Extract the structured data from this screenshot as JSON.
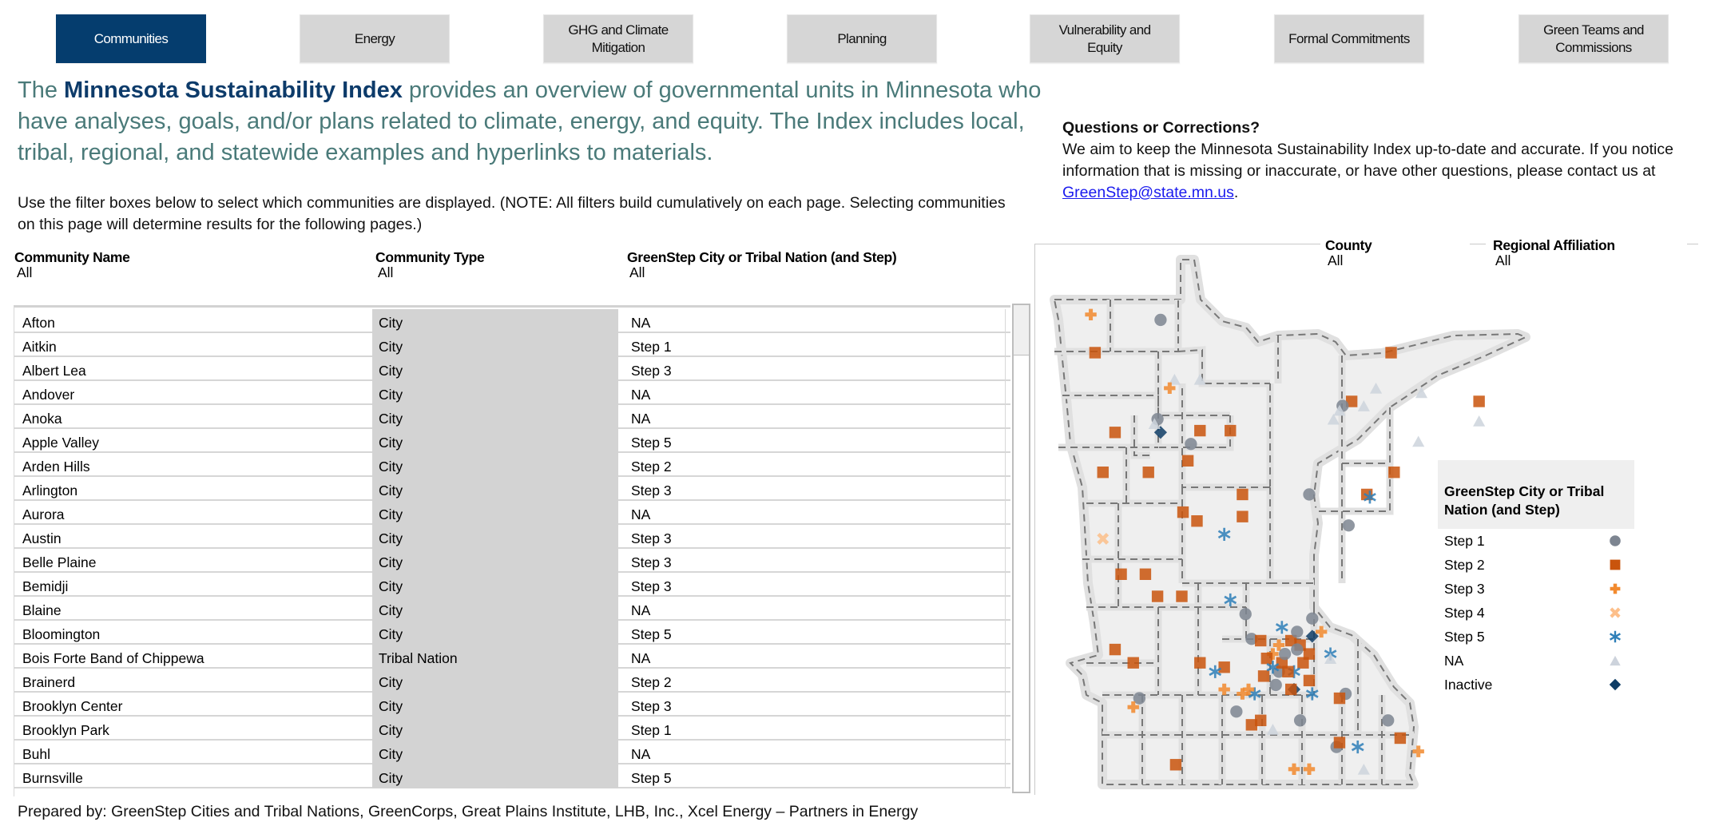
{
  "nav": {
    "tabs": [
      {
        "label": "Communities",
        "active": true
      },
      {
        "label": "Energy",
        "active": false
      },
      {
        "label": "GHG and Climate\nMitigation",
        "active": false
      },
      {
        "label": "Planning",
        "active": false
      },
      {
        "label": "Vulnerability and\nEquity",
        "active": false
      },
      {
        "label": "Formal Commitments",
        "active": false
      },
      {
        "label": "Green Teams and\nCommissions",
        "active": false
      }
    ]
  },
  "intro": {
    "prefix": "The ",
    "emphasis": "Minnesota Sustainability Index",
    "suffix": " provides an overview of governmental units in Minnesota who have analyses, goals, and/or plans related to climate, energy, and equity. The Index includes local, tribal, regional, and statewide examples and hyperlinks to materials."
  },
  "instructions": "Use the filter boxes below to select which communities are displayed. (NOTE: All filters build cumulatively on each page. Selecting communities on this page will determine results for the following pages.)",
  "questions": {
    "heading": "Questions or Corrections?",
    "body": "We aim to keep the Minnesota Sustainability Index up-to-date and accurate. If you notice information that is missing or inaccurate, or have other questions, please contact us at ",
    "email": "GreenStep@state.mn.us",
    "end": "."
  },
  "filters": {
    "community_name": {
      "label": "Community Name",
      "value": "All"
    },
    "community_type": {
      "label": "Community Type",
      "value": "All"
    },
    "greenstep": {
      "label": "GreenStep City or Tribal Nation (and Step)",
      "value": "All"
    },
    "county": {
      "label": "County",
      "value": "All"
    },
    "regional": {
      "label": "Regional Affiliation",
      "value": "All"
    }
  },
  "table": {
    "rows": [
      {
        "name": "Afton",
        "type": "City",
        "step": "NA"
      },
      {
        "name": "Aitkin",
        "type": "City",
        "step": "Step 1"
      },
      {
        "name": "Albert Lea",
        "type": "City",
        "step": "Step 3"
      },
      {
        "name": "Andover",
        "type": "City",
        "step": "NA"
      },
      {
        "name": "Anoka",
        "type": "City",
        "step": "NA"
      },
      {
        "name": "Apple Valley",
        "type": "City",
        "step": "Step 5"
      },
      {
        "name": "Arden Hills",
        "type": "City",
        "step": "Step 2"
      },
      {
        "name": "Arlington",
        "type": "City",
        "step": "Step 3"
      },
      {
        "name": "Aurora",
        "type": "City",
        "step": "NA"
      },
      {
        "name": "Austin",
        "type": "City",
        "step": "Step 3"
      },
      {
        "name": "Belle Plaine",
        "type": "City",
        "step": "Step 3"
      },
      {
        "name": "Bemidji",
        "type": "City",
        "step": "Step 3"
      },
      {
        "name": "Blaine",
        "type": "City",
        "step": "NA"
      },
      {
        "name": "Bloomington",
        "type": "City",
        "step": "Step 5"
      },
      {
        "name": "Bois Forte Band of Chippewa",
        "type": "Tribal Nation",
        "step": "NA"
      },
      {
        "name": "Brainerd",
        "type": "City",
        "step": "Step 2"
      },
      {
        "name": "Brooklyn Center",
        "type": "City",
        "step": "Step 3"
      },
      {
        "name": "Brooklyn Park",
        "type": "City",
        "step": "Step 1"
      },
      {
        "name": "Buhl",
        "type": "City",
        "step": "NA"
      },
      {
        "name": "Burnsville",
        "type": "City",
        "step": "Step 5"
      }
    ]
  },
  "legend": {
    "title": "GreenStep City or Tribal Nation (and Step)",
    "items": [
      {
        "label": "Step 1",
        "symbol": "circle",
        "color": "#7d8591"
      },
      {
        "label": "Step 2",
        "symbol": "square",
        "color": "#c9540c"
      },
      {
        "label": "Step 3",
        "symbol": "plus",
        "color": "#f28a2e"
      },
      {
        "label": "Step 4",
        "symbol": "cross",
        "color": "#fdbf8a"
      },
      {
        "label": "Step 5",
        "symbol": "asterisk",
        "color": "#2e7fb8"
      },
      {
        "label": "NA",
        "symbol": "triangle",
        "color": "#cdd3dc"
      },
      {
        "label": "Inactive",
        "symbol": "diamond",
        "color": "#0f3d66"
      }
    ]
  },
  "map_points": [
    {
      "cat": "Step 3",
      "lon": -96.7,
      "lat": 48.78
    },
    {
      "cat": "Step 2",
      "lon": -96.63,
      "lat": 48.35
    },
    {
      "cat": "Step 1",
      "lon": -95.55,
      "lat": 48.72
    },
    {
      "cat": "NA",
      "lon": -95.32,
      "lat": 48.05
    },
    {
      "cat": "NA",
      "lon": -94.9,
      "lat": 48.05
    },
    {
      "cat": "Step 3",
      "lon": -95.4,
      "lat": 47.95
    },
    {
      "cat": "Step 2",
      "lon": -94.9,
      "lat": 47.47
    },
    {
      "cat": "Step 2",
      "lon": -94.4,
      "lat": 47.47
    },
    {
      "cat": "Step 1",
      "lon": -95.6,
      "lat": 47.6
    },
    {
      "cat": "Inactive",
      "lon": -95.55,
      "lat": 47.45
    },
    {
      "cat": "Step 2",
      "lon": -96.3,
      "lat": 47.45
    },
    {
      "cat": "NA",
      "lon": -95.65,
      "lat": 47.55
    },
    {
      "cat": "Step 1",
      "lon": -95.05,
      "lat": 47.32
    },
    {
      "cat": "Step 2",
      "lon": -95.1,
      "lat": 47.13
    },
    {
      "cat": "Step 2",
      "lon": -95.75,
      "lat": 47.0
    },
    {
      "cat": "Step 2",
      "lon": -96.5,
      "lat": 47.0
    },
    {
      "cat": "Step 2",
      "lon": -94.2,
      "lat": 46.5
    },
    {
      "cat": "Step 2",
      "lon": -94.2,
      "lat": 46.75
    },
    {
      "cat": "Step 2",
      "lon": -95.18,
      "lat": 46.55
    },
    {
      "cat": "Step 2",
      "lon": -94.95,
      "lat": 46.45
    },
    {
      "cat": "Step 4",
      "lon": -96.5,
      "lat": 46.25
    },
    {
      "cat": "Step 5",
      "lon": -94.5,
      "lat": 46.3
    },
    {
      "cat": "Step 2",
      "lon": -96.2,
      "lat": 45.85
    },
    {
      "cat": "Step 2",
      "lon": -95.8,
      "lat": 45.85
    },
    {
      "cat": "Step 2",
      "lon": -95.6,
      "lat": 45.6
    },
    {
      "cat": "Step 2",
      "lon": -95.2,
      "lat": 45.6
    },
    {
      "cat": "Step 5",
      "lon": -94.4,
      "lat": 45.56
    },
    {
      "cat": "Step 1",
      "lon": -94.15,
      "lat": 45.4
    },
    {
      "cat": "Step 1",
      "lon": -94.05,
      "lat": 45.12
    },
    {
      "cat": "Step 2",
      "lon": -93.9,
      "lat": 45.1
    },
    {
      "cat": "Step 5",
      "lon": -93.55,
      "lat": 45.25
    },
    {
      "cat": "Step 3",
      "lon": -93.6,
      "lat": 45.05
    },
    {
      "cat": "Step 3",
      "lon": -93.7,
      "lat": 44.95
    },
    {
      "cat": "Step 2",
      "lon": -93.4,
      "lat": 45.1
    },
    {
      "cat": "Step 2",
      "lon": -93.25,
      "lat": 45.05
    },
    {
      "cat": "Step 2",
      "lon": -93.1,
      "lat": 44.95
    },
    {
      "cat": "Step 2",
      "lon": -93.2,
      "lat": 44.85
    },
    {
      "cat": "Step 1",
      "lon": -93.3,
      "lat": 45.2
    },
    {
      "cat": "Step 1",
      "lon": -93.05,
      "lat": 45.35
    },
    {
      "cat": "Step 5",
      "lon": -93.35,
      "lat": 44.75
    },
    {
      "cat": "Step 2",
      "lon": -93.1,
      "lat": 44.65
    },
    {
      "cat": "Inactive",
      "lon": -93.05,
      "lat": 45.15
    },
    {
      "cat": "Step 3",
      "lon": -92.9,
      "lat": 45.2
    },
    {
      "cat": "Step 5",
      "lon": -92.75,
      "lat": 44.95
    },
    {
      "cat": "Step 1",
      "lon": -92.5,
      "lat": 44.5
    },
    {
      "cat": "Step 2",
      "lon": -92.6,
      "lat": 44.45
    },
    {
      "cat": "Step 5",
      "lon": -92.3,
      "lat": 43.9
    },
    {
      "cat": "Step 1",
      "lon": -92.65,
      "lat": 43.9
    },
    {
      "cat": "Step 2",
      "lon": -92.6,
      "lat": 43.95
    },
    {
      "cat": "Step 2",
      "lon": -91.6,
      "lat": 44.0
    },
    {
      "cat": "Step 3",
      "lon": -91.3,
      "lat": 43.85
    },
    {
      "cat": "NA",
      "lon": -92.2,
      "lat": 43.65
    },
    {
      "cat": "Step 2",
      "lon": -95.3,
      "lat": 43.7
    },
    {
      "cat": "Step 3",
      "lon": -93.35,
      "lat": 43.65
    },
    {
      "cat": "Step 3",
      "lon": -93.1,
      "lat": 43.65
    },
    {
      "cat": "Step 2",
      "lon": -94.05,
      "lat": 44.15
    },
    {
      "cat": "Step 2",
      "lon": -93.9,
      "lat": 44.2
    },
    {
      "cat": "NA",
      "lon": -93.7,
      "lat": 44.1
    },
    {
      "cat": "Step 1",
      "lon": -93.25,
      "lat": 44.2
    },
    {
      "cat": "Step 5",
      "lon": -93.05,
      "lat": 44.5
    },
    {
      "cat": "Step 1",
      "lon": -94.3,
      "lat": 44.3
    },
    {
      "cat": "Step 3",
      "lon": -94.2,
      "lat": 44.5
    },
    {
      "cat": "Step 1",
      "lon": -95.9,
      "lat": 44.45
    },
    {
      "cat": "Step 3",
      "lon": -96.0,
      "lat": 44.35
    },
    {
      "cat": "Step 2",
      "lon": -96.0,
      "lat": 44.85
    },
    {
      "cat": "Step 2",
      "lon": -96.3,
      "lat": 45.0
    },
    {
      "cat": "Step 2",
      "lon": -94.5,
      "lat": 44.8
    },
    {
      "cat": "Step 2",
      "lon": -94.9,
      "lat": 44.85
    },
    {
      "cat": "Step 5",
      "lon": -94.65,
      "lat": 44.75
    },
    {
      "cat": "Step 3",
      "lon": -94.5,
      "lat": 44.55
    },
    {
      "cat": "Step 1",
      "lon": -93.65,
      "lat": 44.6
    },
    {
      "cat": "Step 1",
      "lon": -93.6,
      "lat": 44.75
    },
    {
      "cat": "Step 5",
      "lon": -94.0,
      "lat": 44.5
    },
    {
      "cat": "Step 3",
      "lon": -94.1,
      "lat": 44.55
    },
    {
      "cat": "NA",
      "lon": -92.75,
      "lat": 44.9
    },
    {
      "cat": "Step 2",
      "lon": -93.55,
      "lat": 44.85
    },
    {
      "cat": "Step 2",
      "lon": -93.8,
      "lat": 44.9
    },
    {
      "cat": "Step 2",
      "lon": -93.45,
      "lat": 44.75
    },
    {
      "cat": "Step 1",
      "lon": -93.5,
      "lat": 44.95
    },
    {
      "cat": "Step 1",
      "lon": -93.3,
      "lat": 45.0
    },
    {
      "cat": "Step 2",
      "lon": -93.85,
      "lat": 44.7
    },
    {
      "cat": "Step 5",
      "lon": -93.7,
      "lat": 44.8
    },
    {
      "cat": "Inactive",
      "lon": -93.35,
      "lat": 44.55
    },
    {
      "cat": "Step 2",
      "lon": -93.4,
      "lat": 44.55
    },
    {
      "cat": "Step 1",
      "lon": -91.8,
      "lat": 44.2
    },
    {
      "cat": "Step 2",
      "lon": -92.4,
      "lat": 47.8
    },
    {
      "cat": "Step 1",
      "lon": -92.55,
      "lat": 47.75
    },
    {
      "cat": "NA",
      "lon": -92.6,
      "lat": 47.7
    },
    {
      "cat": "NA",
      "lon": -92.7,
      "lat": 47.6
    },
    {
      "cat": "NA",
      "lon": -92.2,
      "lat": 47.75
    },
    {
      "cat": "NA",
      "lon": -92.0,
      "lat": 47.95
    },
    {
      "cat": "Step 2",
      "lon": -91.75,
      "lat": 48.35
    },
    {
      "cat": "Step 2",
      "lon": -90.3,
      "lat": 47.8
    },
    {
      "cat": "NA",
      "lon": -90.3,
      "lat": 47.58
    },
    {
      "cat": "NA",
      "lon": -91.25,
      "lat": 47.9
    },
    {
      "cat": "NA",
      "lon": -91.3,
      "lat": 47.35
    },
    {
      "cat": "Step 2",
      "lon": -91.7,
      "lat": 47.0
    },
    {
      "cat": "Step 2",
      "lon": -92.15,
      "lat": 46.75
    },
    {
      "cat": "Step 5",
      "lon": -92.1,
      "lat": 46.72
    },
    {
      "cat": "Step 1",
      "lon": -92.45,
      "lat": 46.4
    },
    {
      "cat": "Step 1",
      "lon": -93.1,
      "lat": 46.75
    }
  ],
  "footer": "Prepared by: GreenStep Cities and Tribal Nations, GreenCorps, Great Plains Institute, LHB, Inc., Xcel Energy – Partners in Energy"
}
